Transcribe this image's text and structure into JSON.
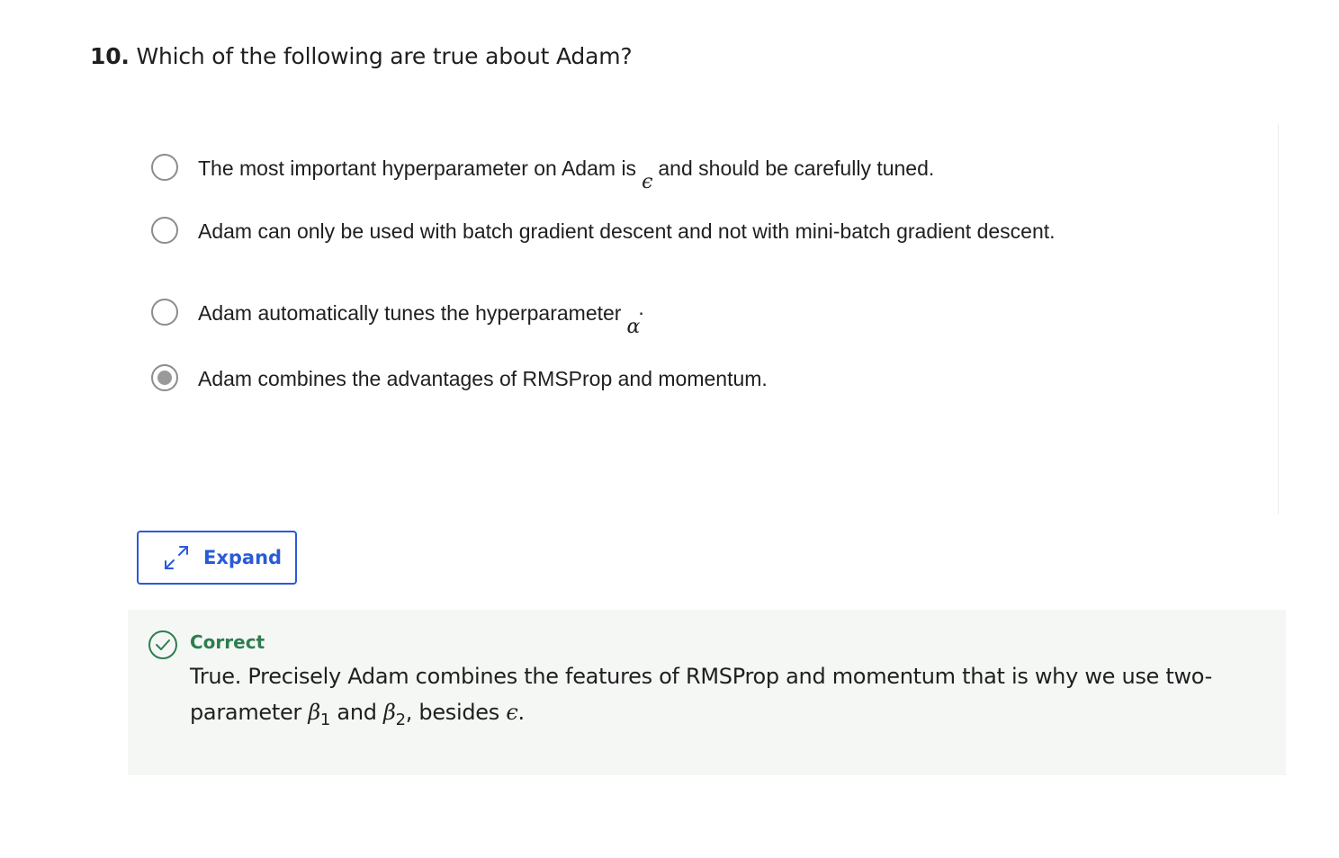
{
  "question": {
    "number": "10.",
    "text": "Which of the following are true about Adam?"
  },
  "options": [
    {
      "before": "The most important hyperparameter on Adam is",
      "math": "ϵ",
      "after": "and should be carefully tuned.",
      "selected": false
    },
    {
      "before": "Adam can only be used with batch gradient descent and not with mini-batch gradient descent.",
      "math": "",
      "after": "",
      "selected": false
    },
    {
      "before": "Adam automatically tunes the hyperparameter",
      "math": "α",
      "after": ".",
      "selected": false
    },
    {
      "before": "Adam combines the advantages of RMSProp and momentum.",
      "math": "",
      "after": "",
      "selected": true
    }
  ],
  "expand_button": {
    "label": "Expand",
    "icon": "expand-arrows-icon",
    "color": "#2a5bd7"
  },
  "feedback": {
    "status": "Correct",
    "status_color": "#2e7d4f",
    "text_part1": "True. Precisely Adam combines the features of RMSProp and momentum that is why we use two-parameter ",
    "beta": "β",
    "sub1": "1",
    "and": " and ",
    "sub2": "2",
    "comma": ", besides ",
    "epsilon": "ϵ",
    "end": "."
  }
}
